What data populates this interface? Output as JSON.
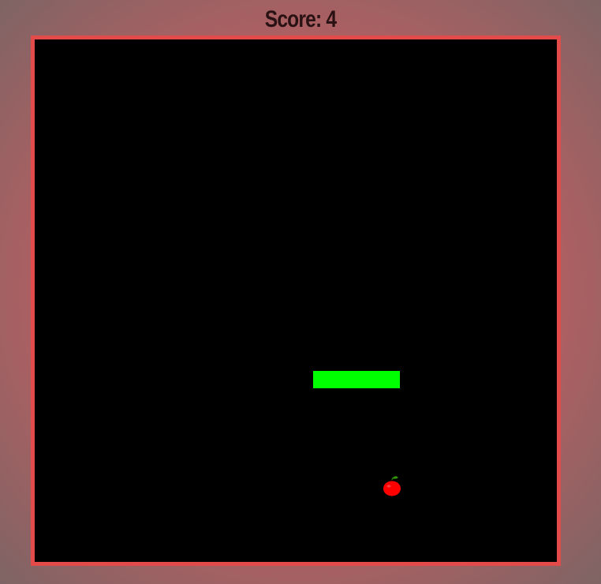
{
  "header": {
    "score_label": "Score: 4"
  },
  "game": {
    "snake_color": "#00ff00",
    "apple_color": "#ff0000",
    "border_color": "#e34a4a",
    "board_color": "#000000",
    "apple_icon": "apple-icon"
  }
}
